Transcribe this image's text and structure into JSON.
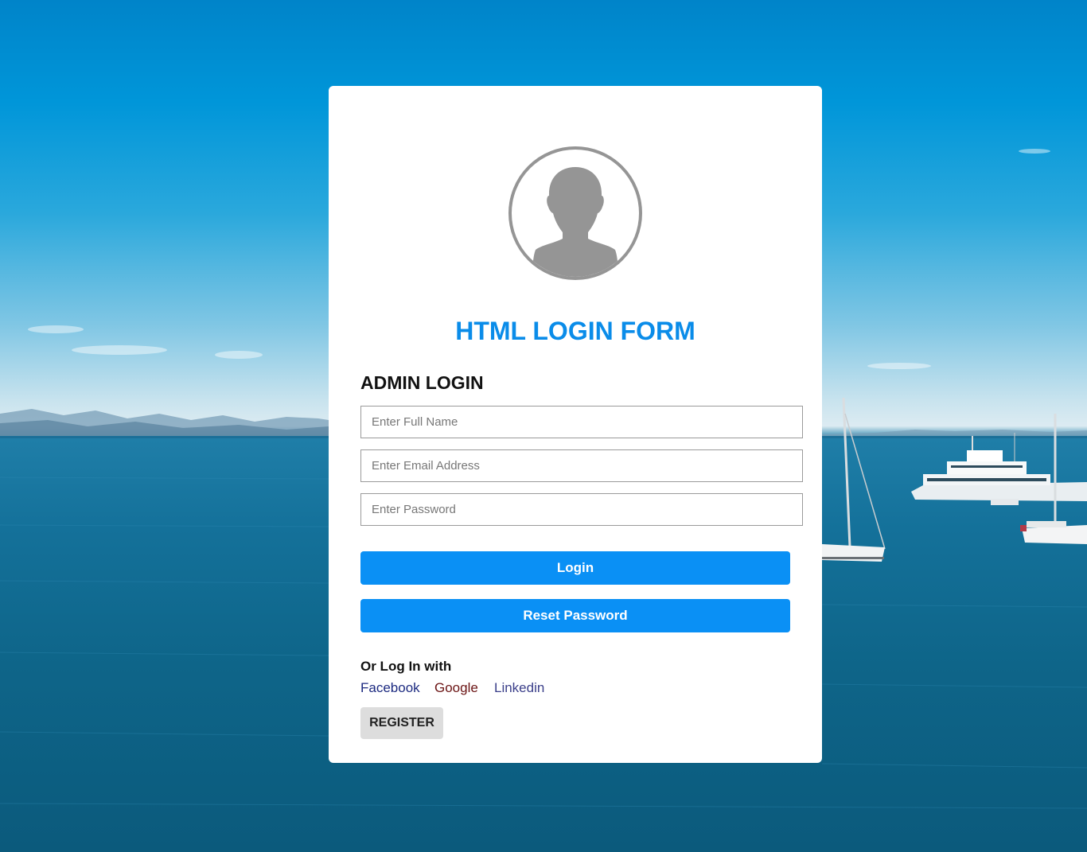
{
  "form": {
    "title": "HTML LOGIN FORM",
    "subtitle": "ADMIN LOGIN",
    "fields": {
      "name_placeholder": "Enter Full Name",
      "email_placeholder": "Enter Email Address",
      "password_placeholder": "Enter Password"
    },
    "buttons": {
      "login": "Login",
      "reset": "Reset Password",
      "register": "REGISTER"
    },
    "social": {
      "heading": "Or Log In with",
      "links": [
        "Facebook",
        "Google",
        "Linkedin"
      ]
    }
  },
  "colors": {
    "accent": "#0a90f5",
    "title": "#0a8ce9",
    "facebook": "#1c2a80",
    "google": "#6b1414",
    "linkedin": "#3b3f8a",
    "register_bg": "#dddddd",
    "avatar": "#959595"
  },
  "icons": {
    "avatar": "user-silhouette-icon"
  }
}
